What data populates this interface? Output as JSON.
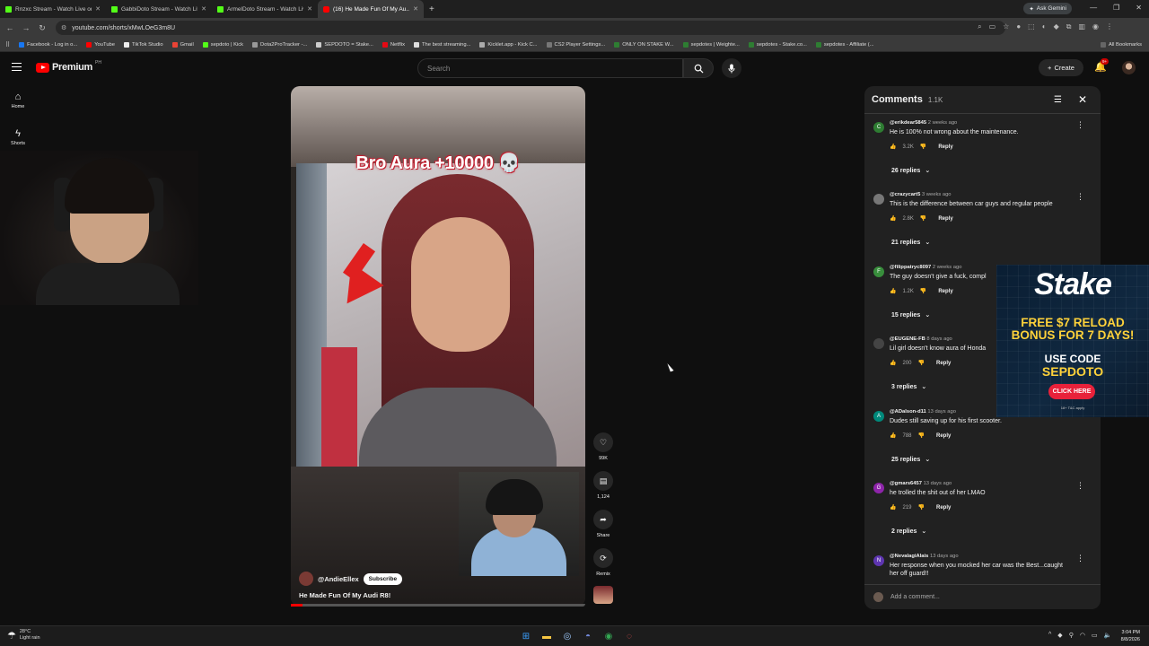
{
  "browser": {
    "tabs": [
      {
        "label": "Rnzxc Stream - Watch Live on K",
        "active": false
      },
      {
        "label": "GabbiDoto Stream - Watch Live",
        "active": false
      },
      {
        "label": "ArmelDoto Stream - Watch Live",
        "active": false
      },
      {
        "label": "(16) He Made Fun Of My Au...",
        "active": true
      }
    ],
    "ask_gemini": "Ask Gemini",
    "url": "youtube.com/shorts/xMwLOeG3m8U",
    "bookmarks": [
      "Facebook - Log in o...",
      "YouTube",
      "TikTok Studio",
      "Gmail",
      "sepdoto | Kick",
      "Dota2ProTracker -...",
      "SEPDOTO = Stake...",
      "Netflix",
      "The best streaming...",
      "Kicklet.app - Kick C...",
      "CS2 Player Settings...",
      "ONLY ON STAKE W...",
      "sepdotes | Weighte...",
      "sepdotes - Stake.co...",
      "sepdotes - Affiliate (..."
    ],
    "all_bookmarks": "All Bookmarks"
  },
  "youtube": {
    "logo_text": "Premium",
    "region": "PH",
    "search_placeholder": "Search",
    "create_label": "Create",
    "notif_badge": "9+",
    "sidebar": [
      {
        "label": "Home",
        "icon": "home-icon"
      },
      {
        "label": "Shorts",
        "icon": "shorts-icon"
      }
    ]
  },
  "short": {
    "overlay_caption": "Bro Aura +10000 💀",
    "channel": "@AndieEllex",
    "subscribe": "Subscribe",
    "title": "He Made Fun Of My Audi R8!",
    "progress": 0.04,
    "actions": {
      "likes": "99K",
      "comments": "1,124",
      "share": "Share",
      "remix": "Remix"
    }
  },
  "comments": {
    "title": "Comments",
    "count": "1.1K",
    "add_placeholder": "Add a comment...",
    "reply_label": "Reply",
    "items": [
      {
        "user": "@erikdear5845",
        "time": "2 weeks ago",
        "text": "He is 100% not wrong about the maintenance.",
        "likes": "3.2K",
        "replies": "26 replies",
        "avatar_letter": "C",
        "avatar_color": "#2e7d32"
      },
      {
        "user": "@crazycart5",
        "time": "3 weeks ago",
        "text": "This is the difference between car guys and regular people",
        "likes": "2.8K",
        "replies": "21 replies",
        "avatar_letter": "",
        "avatar_color": "#777777"
      },
      {
        "user": "@filippatryc8097",
        "time": "2 weeks ago",
        "text": "The guy doesn't give a fuck, compl",
        "likes": "1.2K",
        "replies": "15 replies",
        "avatar_letter": "F",
        "avatar_color": "#388e3c"
      },
      {
        "user": "@EUGENE-FB",
        "time": "8 days ago",
        "text": "Lil girl doesn't know aura of Honda",
        "likes": "200",
        "replies": "3 replies",
        "avatar_letter": "",
        "avatar_color": "#444444"
      },
      {
        "user": "@ADalson-d11",
        "time": "13 days ago",
        "text": "Dudes still saving up for his first scooter.",
        "likes": "788",
        "replies": "25 replies",
        "avatar_letter": "A",
        "avatar_color": "#00897b"
      },
      {
        "user": "@gmars6457",
        "time": "13 days ago",
        "text": "he trolled the shit out of her LMAO",
        "likes": "219",
        "replies": "2 replies",
        "avatar_letter": "G",
        "avatar_color": "#8e24aa"
      },
      {
        "user": "@NevalagiAlais",
        "time": "13 days ago",
        "text": "Her response  when you mocked her car was the Best...caught",
        "likes": "",
        "replies": "",
        "avatar_letter": "N",
        "avatar_color": "#5e35b1"
      }
    ],
    "last_line2": "her off guard!!"
  },
  "ad": {
    "brand": "Stake",
    "line1": "FREE $7 RELOAD",
    "line2": "BONUS FOR 7 DAYS!",
    "line3": "USE CODE",
    "code": "SEPDOTO",
    "cta": "CLICK HERE",
    "fine": "18+ T&C apply"
  },
  "taskbar": {
    "temp": "28°C",
    "weather": "Light rain",
    "time": "3:04 PM",
    "date": "8/8/2026"
  }
}
